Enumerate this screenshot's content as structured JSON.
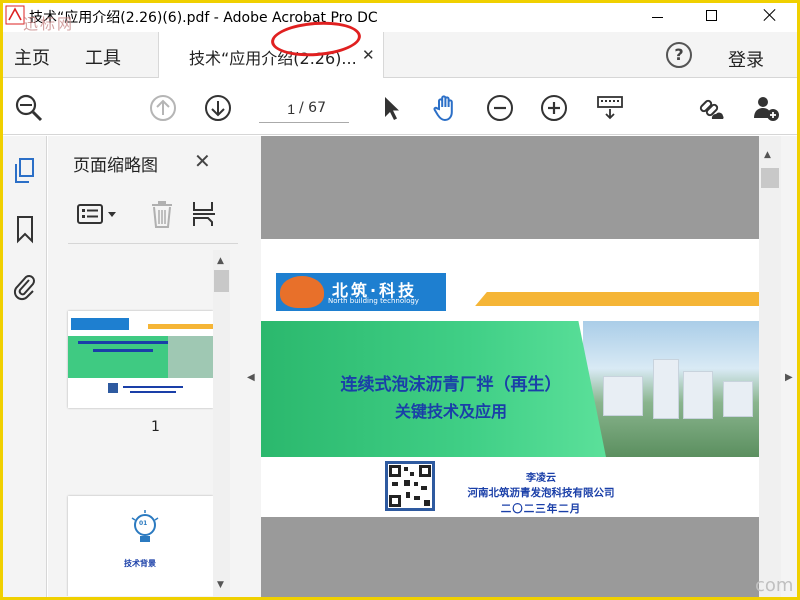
{
  "window": {
    "title": "技术“应用介绍(2.26)(6).pdf - Adobe Acrobat Pro DC",
    "watermark_text": "迅标网"
  },
  "menubar": {
    "home": "主页",
    "tools": "工具",
    "doc_tab": "技术“应用介绍(2.26)...",
    "help": "?",
    "signin": "登录"
  },
  "toolbar": {
    "page_current": "1",
    "page_total": "/ 67"
  },
  "thumbnails_panel": {
    "title": "页面缩略图",
    "page_label": "1",
    "thumb2_badge": "01",
    "thumb2_caption": "技术背景"
  },
  "slide": {
    "logo_cn": "北筑·科技",
    "logo_en": "North building technology",
    "title_line1": "连续式泡沫沥青厂拌（再生）",
    "title_line2": "关键技术及应用",
    "presenter": "李凌云",
    "company": "河南北筑沥青发泡科技有限公司",
    "date": "二〇二三年二月"
  },
  "corner_watermark": "com",
  "colors": {
    "accent_blue": "#2b6fc7",
    "slide_green": "#40cf86",
    "slide_text_blue": "#1a3fa8",
    "annotation_red": "#e02020"
  },
  "icons": {
    "search": "search-icon",
    "prev_page": "arrow-up-circle-icon",
    "next_page": "arrow-down-circle-icon",
    "select": "cursor-arrow-icon",
    "hand": "hand-icon",
    "zoom_out": "zoom-out-icon",
    "zoom_in": "zoom-in-icon",
    "keyboard": "keyboard-icon",
    "link_cloud": "share-link-icon",
    "add_user": "add-user-icon"
  }
}
